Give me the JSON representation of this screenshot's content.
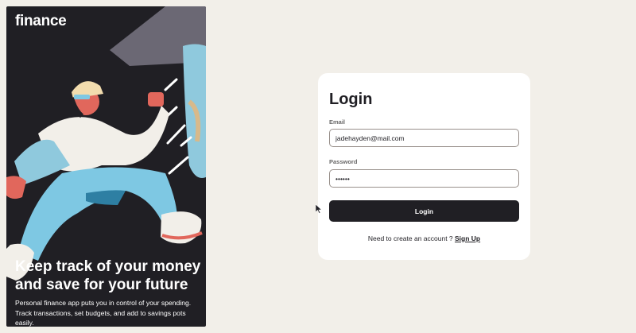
{
  "hero": {
    "logo": "finance",
    "headline": "Keep track of your money and save for your future",
    "subtitle": "Personal finance app puts you in control of your spending. Track transactions, set budgets, and add to savings pots easily."
  },
  "login": {
    "title": "Login",
    "email_label": "Email",
    "email_value": "jadehayden@mail.com",
    "password_label": "Password",
    "password_value": "••••••",
    "submit_label": "Login",
    "signup_prompt": "Need to create an account ? ",
    "signup_link": "Sign Up"
  },
  "colors": {
    "background": "#f2efe9",
    "dark": "#201f24",
    "card": "#ffffff",
    "accent_blue": "#7ec8e3"
  }
}
